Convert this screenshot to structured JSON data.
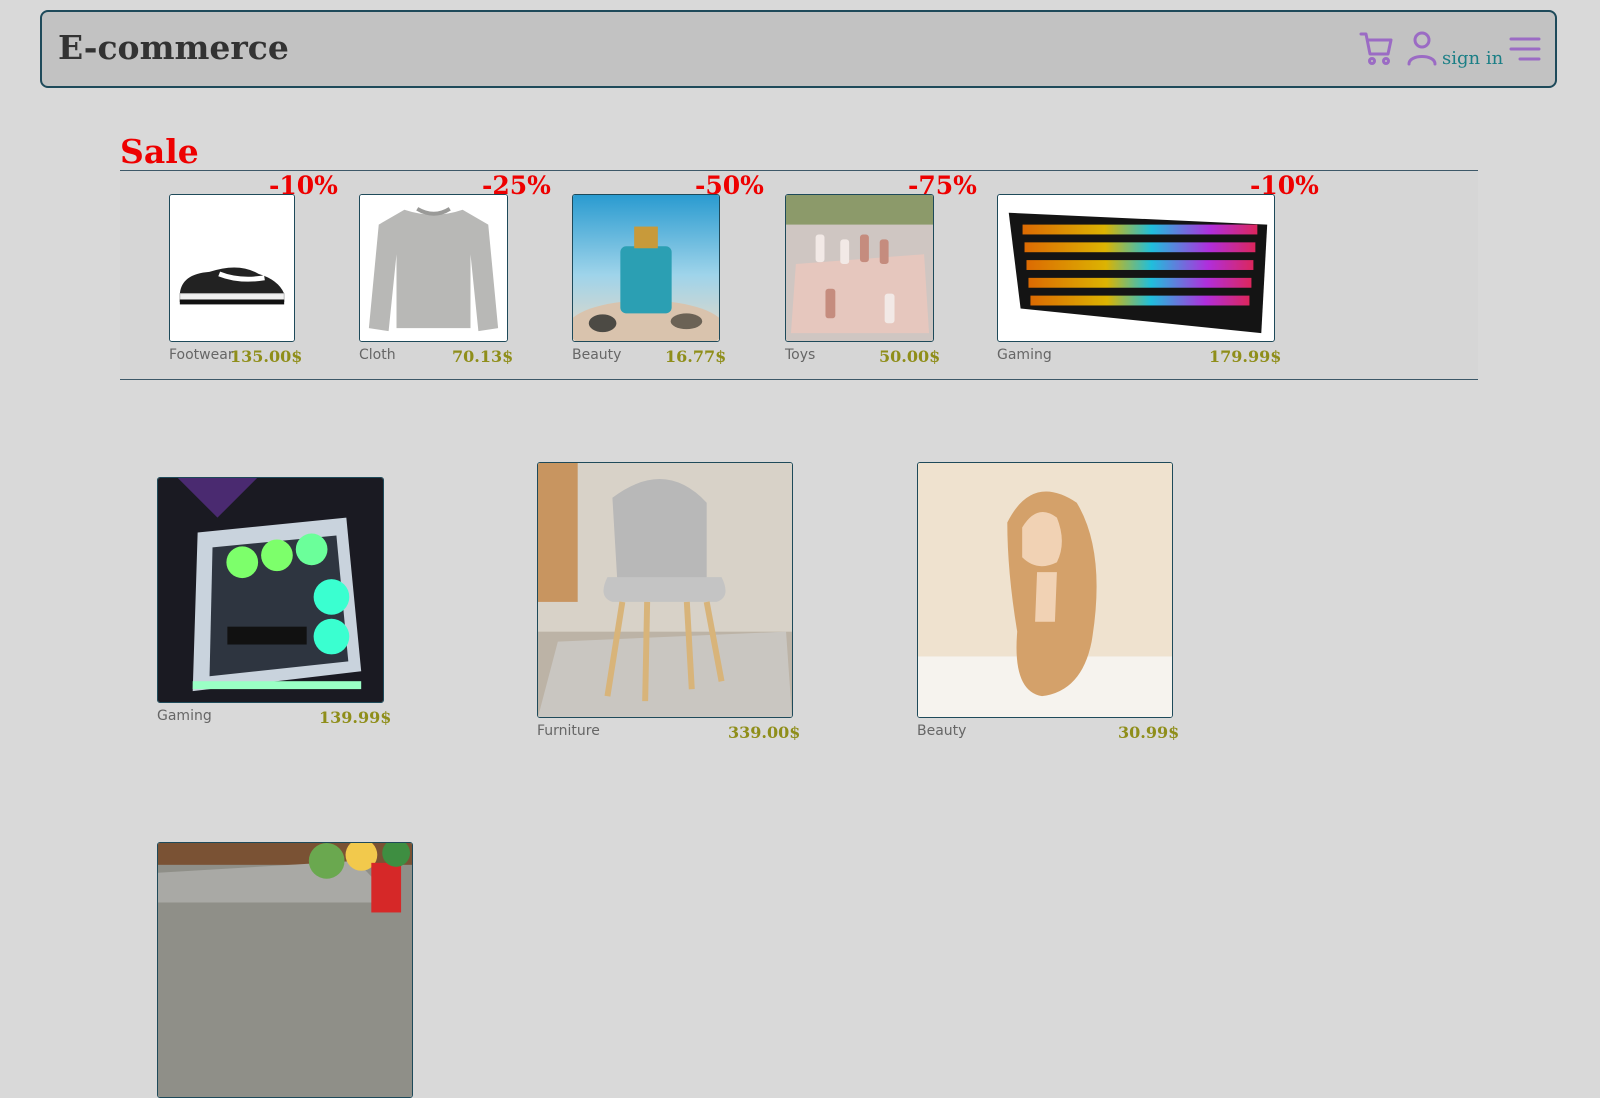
{
  "header": {
    "brand": "E-commerce",
    "signin": "sign in"
  },
  "sale": {
    "title": "Sale",
    "items": [
      {
        "discount": "-10%",
        "category": "Footwear",
        "price": "135.00$"
      },
      {
        "discount": "-25%",
        "category": "Cloth",
        "price": "70.13$"
      },
      {
        "discount": "-50%",
        "category": "Beauty",
        "price": "16.77$"
      },
      {
        "discount": "-75%",
        "category": "Toys",
        "price": "50.00$"
      },
      {
        "discount": "-10%",
        "category": "Gaming",
        "price": "179.99$"
      }
    ]
  },
  "products": [
    {
      "category": "Gaming",
      "price": "139.99$"
    },
    {
      "category": "Furniture",
      "price": "339.00$"
    },
    {
      "category": "Beauty",
      "price": "30.99$"
    }
  ],
  "colors": {
    "accent_red": "#ee0000",
    "price_olive": "#8f8e1a",
    "icon_purple": "#9b6bc4",
    "link_teal": "#1b7f86"
  }
}
